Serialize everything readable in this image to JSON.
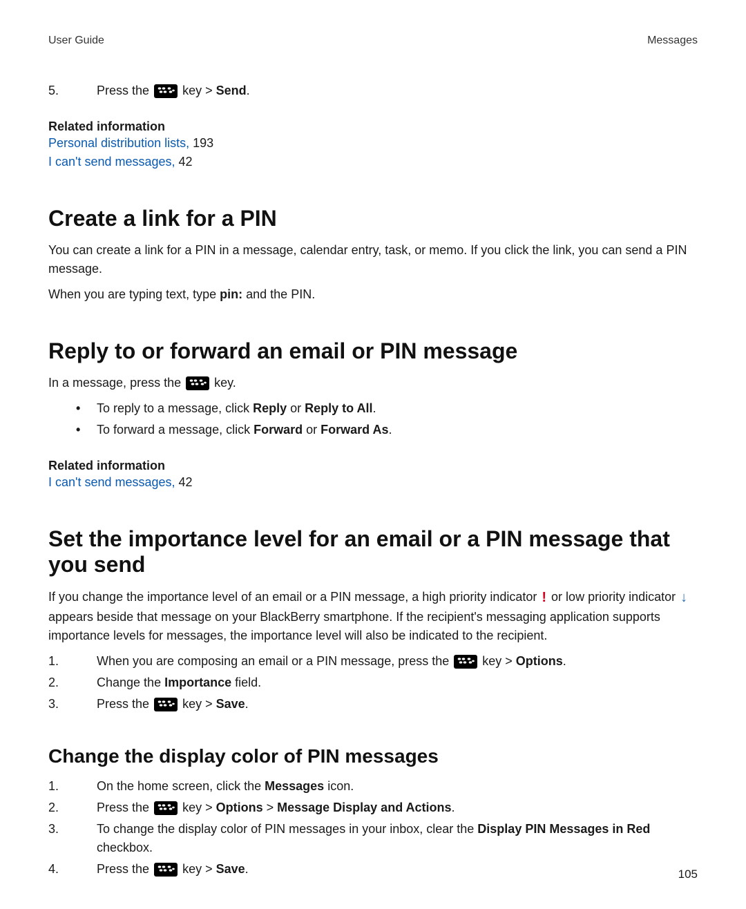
{
  "header": {
    "left": "User Guide",
    "right": "Messages"
  },
  "step5": {
    "num": "5.",
    "pre": "Press the ",
    "mid": " key > ",
    "bold": "Send",
    "post": "."
  },
  "related1": {
    "heading": "Related information",
    "link1": "Personal distribution lists,",
    "page1": " 193",
    "link2": "I can't send messages,",
    "page2": " 42"
  },
  "sec1": {
    "title": "Create a link for a PIN",
    "p1": "You can create a link for a PIN in a message, calendar entry, task, or memo. If you click the link, you can send a PIN message.",
    "p2_pre": "When you are typing text, type ",
    "p2_bold": "pin:",
    "p2_post": " and the PIN."
  },
  "sec2": {
    "title": "Reply to or forward an email or PIN message",
    "intro_pre": "In a message, press the ",
    "intro_post": " key.",
    "b1_pre": "To reply to a message, click ",
    "b1_b1": "Reply",
    "b1_mid": " or ",
    "b1_b2": "Reply to All",
    "b1_post": ".",
    "b2_pre": "To forward a message, click ",
    "b2_b1": "Forward",
    "b2_mid": " or ",
    "b2_b2": "Forward As",
    "b2_post": "."
  },
  "related2": {
    "heading": "Related information",
    "link1": "I can't send messages,",
    "page1": " 42"
  },
  "sec3": {
    "title": "Set the importance level for an email or a PIN message that you send",
    "p_pre": "If you change the importance level of an email or a PIN message, a high priority indicator ",
    "high": "!",
    "p_mid": " or low priority indicator ",
    "low": "↓",
    "p_post": " appears beside that message on your BlackBerry smartphone. If the recipient's messaging application supports importance levels for messages, the importance level will also be indicated to the recipient.",
    "o1_num": "1.",
    "o1_pre": "When you are composing an email or a PIN message, press the ",
    "o1_mid": " key > ",
    "o1_bold": "Options",
    "o1_post": ".",
    "o2_num": "2.",
    "o2_pre": "Change the ",
    "o2_bold": "Importance",
    "o2_post": " field.",
    "o3_num": "3.",
    "o3_pre": "Press the ",
    "o3_mid": " key > ",
    "o3_bold": "Save",
    "o3_post": "."
  },
  "sec4": {
    "title": "Change the display color of PIN messages",
    "o1_num": "1.",
    "o1_pre": "On the home screen, click the ",
    "o1_bold": "Messages",
    "o1_post": " icon.",
    "o2_num": "2.",
    "o2_pre": "Press the ",
    "o2_mid": " key > ",
    "o2_b1": "Options",
    "o2_sep": " > ",
    "o2_b2": "Message Display and Actions",
    "o2_post": ".",
    "o3_num": "3.",
    "o3_pre": "To change the display color of PIN messages in your inbox, clear the ",
    "o3_bold": "Display PIN Messages in Red",
    "o3_post": " checkbox.",
    "o4_num": "4.",
    "o4_pre": "Press the ",
    "o4_mid": " key > ",
    "o4_bold": "Save",
    "o4_post": "."
  },
  "page_number": "105"
}
